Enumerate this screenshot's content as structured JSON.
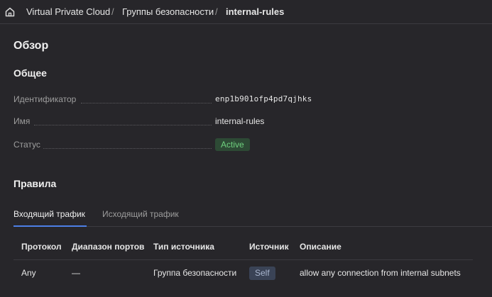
{
  "breadcrumb": {
    "items": [
      "Virtual Private Cloud",
      "Группы безопасности",
      "internal-rules"
    ],
    "separator": "/"
  },
  "overview": {
    "title": "Обзор",
    "section_title": "Общее",
    "properties": {
      "id": {
        "label": "Идентификатор",
        "value": "enp1b901ofp4pd7qjhks"
      },
      "name": {
        "label": "Имя",
        "value": "internal-rules"
      },
      "status": {
        "label": "Статус",
        "value": "Active"
      }
    }
  },
  "rules": {
    "title": "Правила",
    "tabs": [
      {
        "label": "Входящий трафик",
        "active": true
      },
      {
        "label": "Исходящий трафик",
        "active": false
      }
    ],
    "columns": [
      "Протокол",
      "Диапазон портов",
      "Тип источника",
      "Источник",
      "Описание"
    ],
    "rows": [
      {
        "protocol": "Any",
        "port_range": "—",
        "source_type": "Группа безопасности",
        "source": "Self",
        "description": "allow any connection from internal subnets"
      }
    ]
  },
  "colors": {
    "background": "#27262a",
    "status_active_bg": "#2d4a35",
    "status_active_text": "#6fd17f",
    "tab_accent": "#4d7fe6"
  },
  "icons": {
    "home": "home-icon"
  }
}
